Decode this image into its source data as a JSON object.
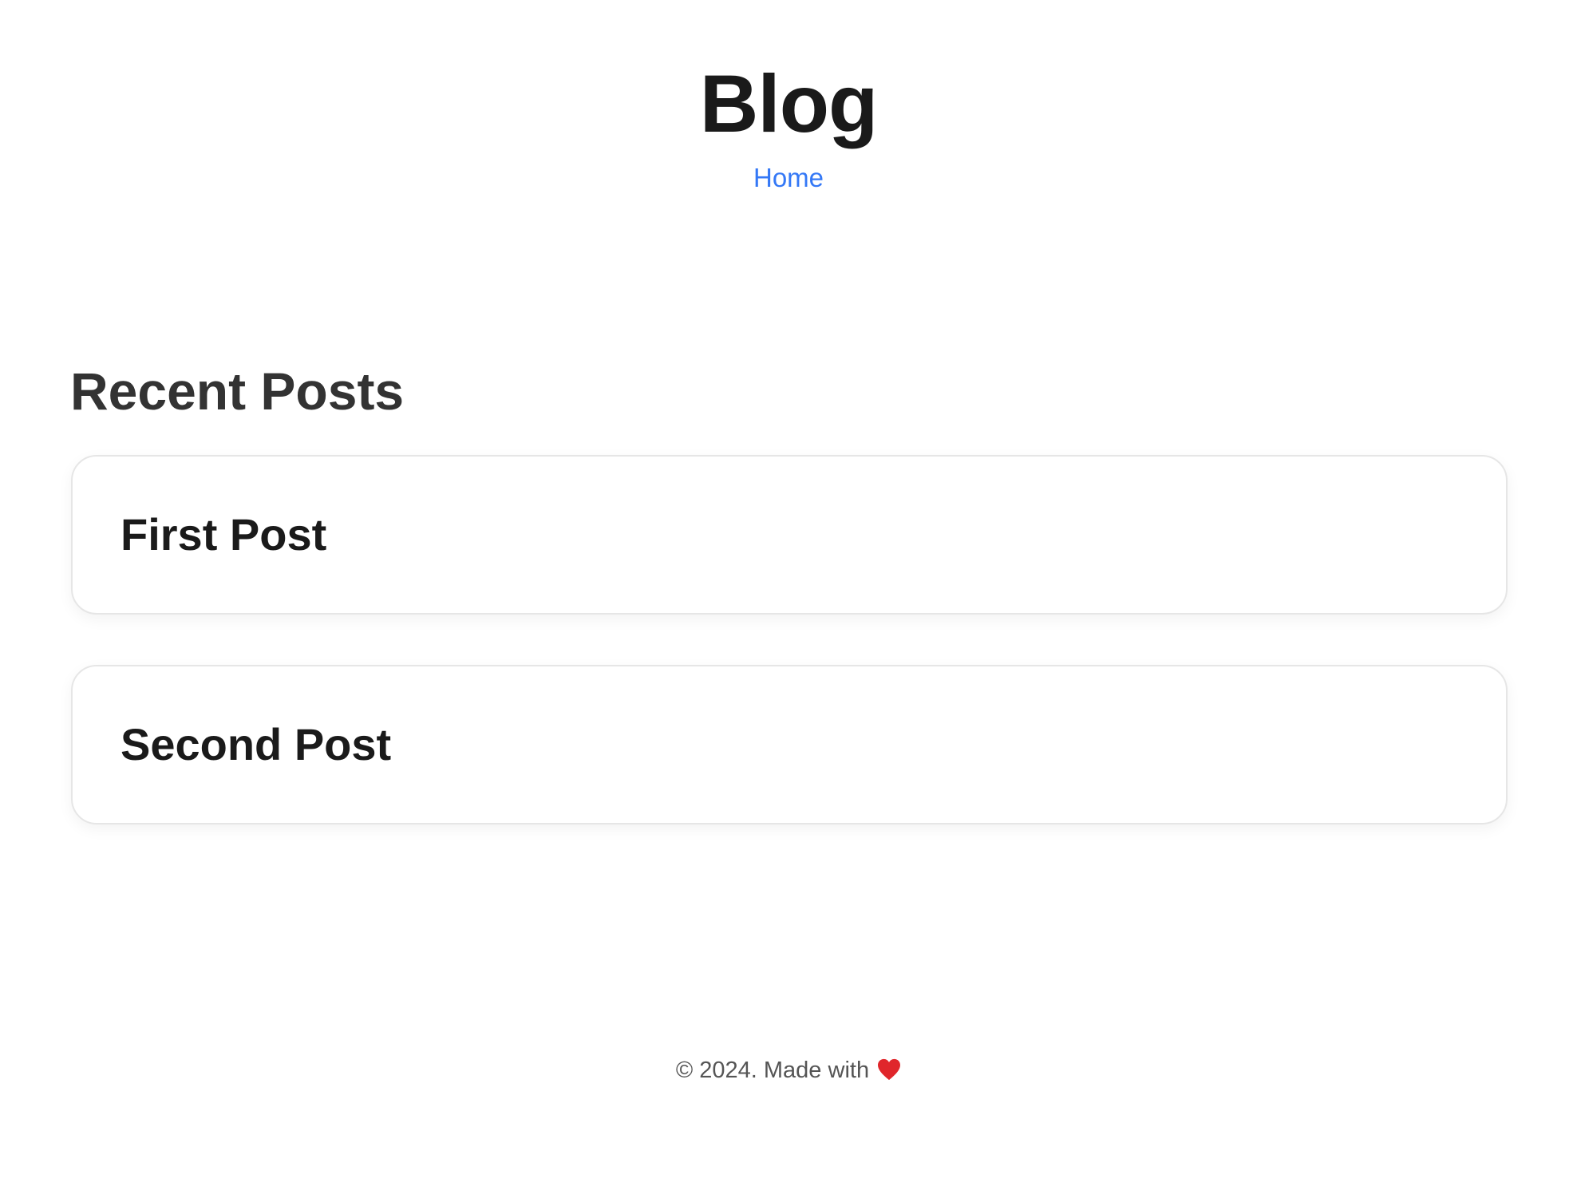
{
  "header": {
    "title": "Blog",
    "nav": [
      {
        "label": "Home"
      }
    ]
  },
  "main": {
    "section_title": "Recent Posts",
    "posts": [
      {
        "title": "First Post"
      },
      {
        "title": "Second Post"
      }
    ]
  },
  "footer": {
    "text": "© 2024. Made with",
    "icon": "heart-icon"
  },
  "colors": {
    "link": "#3478f6",
    "heart": "#e0262b",
    "text": "#1a1a1a"
  }
}
